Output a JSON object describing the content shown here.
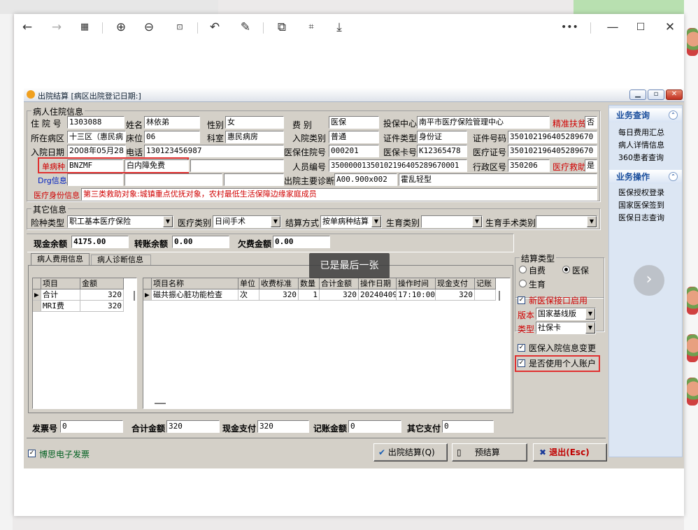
{
  "viewer": {
    "toolbar_icons": [
      "back-arrow-icon",
      "forward-arrow-icon",
      "grid-icon",
      "zoom-in-icon",
      "zoom-out-icon",
      "actual-size-icon",
      "rotate-icon",
      "edit-icon",
      "ocr-icon",
      "translate-icon",
      "download-icon",
      "more-icon",
      "minimize-icon",
      "maximize-icon",
      "close-icon"
    ],
    "toast": "已是最后一张"
  },
  "app": {
    "title": "出院结算 [病区出院登记日期:]",
    "patient_info": {
      "group_title": "病人住院信息",
      "admission_no_label": "住 院 号",
      "admission_no": "1303088",
      "name_label": "姓名",
      "name": "林依弟",
      "gender_label": "性别",
      "gender": "女",
      "fee_type_label": "费    别",
      "fee_type": "医保",
      "insured_center_label": "投保中心",
      "insured_center": "南平市医疗保险管理中心",
      "poverty_label": "精准扶贫",
      "poverty": "否",
      "ward_label": "所在病区",
      "ward": "十三区（惠民病",
      "bed_label": "床位",
      "bed": "06",
      "dept_label": "科室",
      "dept": "惠民病房",
      "admit_type_label": "入院类别",
      "admit_type": "普通",
      "id_type_label": "证件类型",
      "id_type": "身份证",
      "id_no_label": "证件号码",
      "id_no": "350102196405289670",
      "admit_date_label": "入院日期",
      "admit_date": "2008年05月28",
      "phone_label": "电话",
      "phone": "130123456987",
      "ins_admit_no_label": "医保住院号",
      "ins_admit_no": "000201",
      "ins_card_label": "医保卡号",
      "ins_card": "K12365478",
      "med_cert_label": "医疗证号",
      "med_cert": "350102196405289670",
      "single_disease_label": "单病种",
      "single_disease_code": "BNZMF",
      "single_disease_name": "白内障免费",
      "person_no_label": "人员编号",
      "person_no": "35000001350102196405289670001",
      "region_label": "行政区号",
      "region": "350206",
      "aid_label": "医疗救助",
      "aid": "是",
      "drg_label": "Drg信息",
      "discharge_diag_label": "出院主要诊断",
      "discharge_diag_code": "A00.900x002",
      "discharge_diag_name": "霍乱轻型",
      "identity_label": "医疗身份信息",
      "identity": "第三类救助对象:城镇重点优抚对象，农村最低生活保障边缘家庭成员"
    },
    "other_info": {
      "group_title": "其它信息",
      "ins_type_label": "险种类型",
      "ins_type": "职工基本医疗保险",
      "med_type_label": "医疗类别",
      "med_type": "日间手术",
      "settle_mode_label": "结算方式",
      "settle_mode": "按单病种结算",
      "birth_type_label": "生育类别",
      "birth_type": "",
      "birth_surgery_label": "生育手术类别",
      "birth_surgery": ""
    },
    "balance": {
      "cash_label": "现金余额",
      "cash": "4175.00",
      "transfer_label": "转账余额",
      "transfer": "0.00",
      "owed_label": "欠费金额",
      "owed": "0.00"
    },
    "tabs": [
      "病人费用信息",
      "病人诊断信息"
    ],
    "summary_table": {
      "headers": [
        "项目",
        "金额"
      ],
      "rows": [
        [
          "合计",
          "320"
        ],
        [
          "MRI费",
          "320"
        ]
      ]
    },
    "detail_table": {
      "headers": [
        "项目名称",
        "单位",
        "收费标准",
        "数量",
        "合计金额",
        "操作日期",
        "操作时间",
        "现金支付",
        "记账"
      ],
      "rows": [
        [
          "磁共振心脏功能检查",
          "次",
          "320",
          "1",
          "320",
          "20240409",
          "17:10:00",
          "320",
          ""
        ]
      ]
    },
    "settle_type": {
      "group_title": "结算类型",
      "options": [
        "自费",
        "医保",
        "生育"
      ],
      "selected": "医保",
      "ins_interface_label": "新医保接口启用",
      "version_label": "版本",
      "version": "国家基线版",
      "type_label": "类型",
      "type": "社保卡",
      "ins_admit_change_label": "医保入院信息变更",
      "personal_account_label": "是否使用个人账户"
    },
    "footer": {
      "invoice_label": "发票号",
      "invoice": "0",
      "total_label": "合计金额",
      "total": "320",
      "cash_pay_label": "现金支付",
      "cash_pay": "320",
      "account_label": "记账金额",
      "account": "0",
      "other_label": "其它支付",
      "other": "0",
      "einvoice_label": "博思电子发票",
      "discharge_btn": "出院结算(Q)",
      "pre_settle_btn": "预结算",
      "exit_btn": "退出(Esc)"
    },
    "sidebar": {
      "query_title": "业务查询",
      "query_items": [
        "每日费用汇总",
        "病人详情信息",
        "360患者查询"
      ],
      "ops_title": "业务操作",
      "ops_items": [
        "医保授权登录",
        "国家医保签到",
        "医保日志查询"
      ]
    }
  }
}
